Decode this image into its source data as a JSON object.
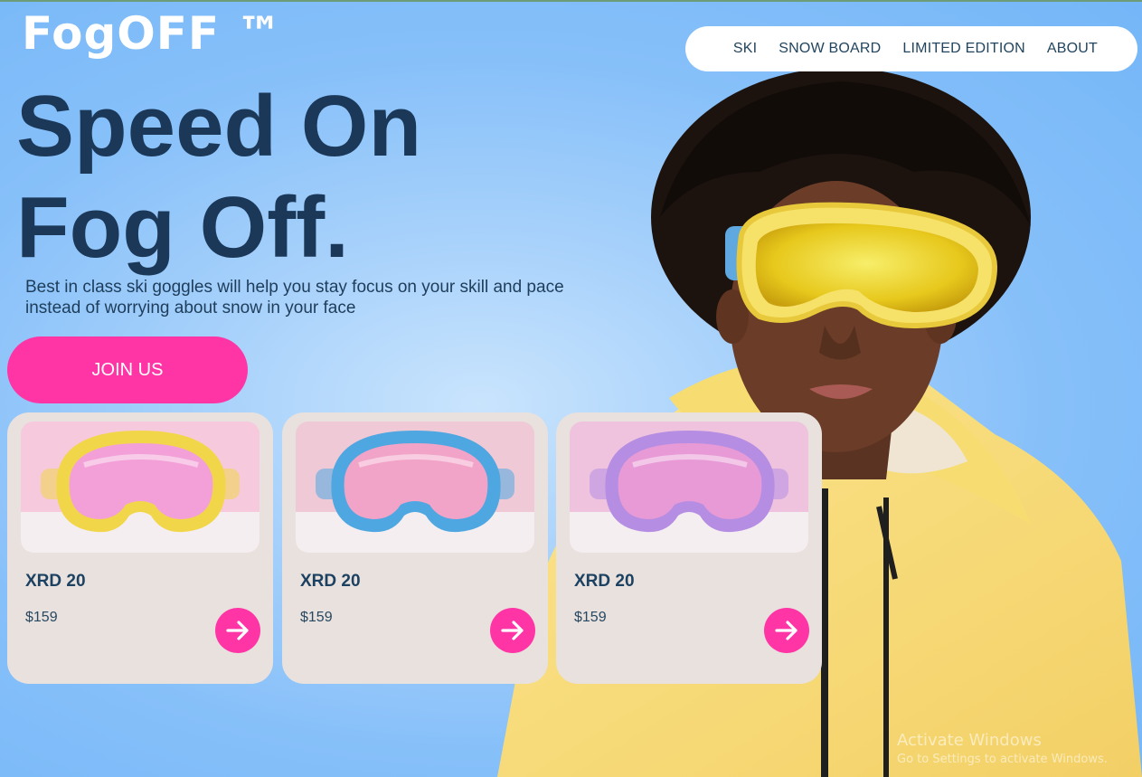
{
  "brand": {
    "logo": "FogOFF ™"
  },
  "nav": {
    "items": [
      "SKI",
      "SNOW BOARD",
      "LIMITED EDITION",
      "ABOUT"
    ]
  },
  "hero": {
    "headline_line1": "Speed On",
    "headline_line2": "Fog Off.",
    "subtext_line1": "Best in class ski goggles will help you stay focus on your skill and pace",
    "subtext_line2": "instead of worrying about snow in your face",
    "cta_label": "JOIN US"
  },
  "products": [
    {
      "name": "XRD 20",
      "price": "$159",
      "frame_color": "#f2d64a",
      "lens_color": "#f3a0d8",
      "bg_color": "#f6c9dd"
    },
    {
      "name": "XRD 20",
      "price": "$159",
      "frame_color": "#4ea7e0",
      "lens_color": "#f2a3c8",
      "bg_color": "#f0c9d7"
    },
    {
      "name": "XRD 20",
      "price": "$159",
      "frame_color": "#b58ee3",
      "lens_color": "#e89ad6",
      "bg_color": "#efc3de"
    }
  ],
  "watermark": {
    "line1": "Activate Windows",
    "line2": "Go to Settings to activate Windows."
  },
  "colors": {
    "accent": "#ff35a6",
    "heading": "#1b3858",
    "card_bg": "#e8e1de"
  },
  "icons": {
    "product_action": "arrow-right-icon"
  }
}
